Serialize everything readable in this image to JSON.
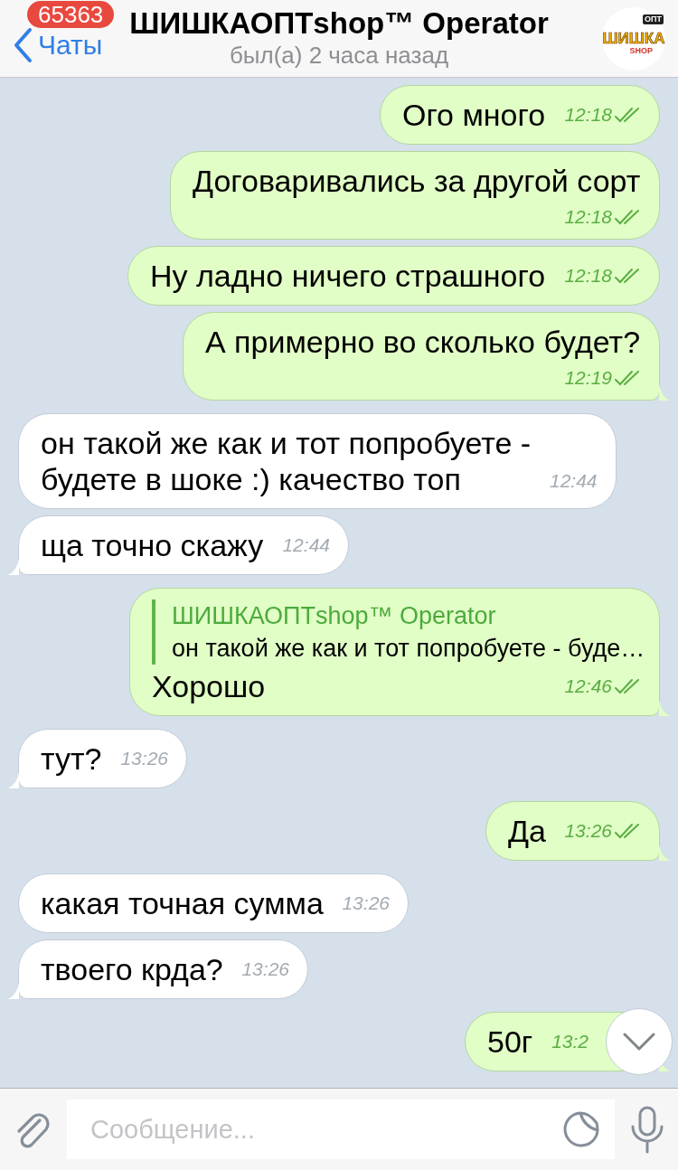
{
  "header": {
    "back_label": "Чаты",
    "unread_badge": "65363",
    "title": "ШИШКАОПТshop™ Operator",
    "status": "был(а) 2 часа назад",
    "avatar": {
      "logo_text": "ШИШКА",
      "logo_subtext": "SHOP",
      "logo_badge": "ОПТ"
    }
  },
  "messages": [
    {
      "kind": "outgoing",
      "text": "Ого много",
      "time": "12:18",
      "read": true,
      "tail": false
    },
    {
      "kind": "outgoing",
      "text": "Договаривались за другой сорт",
      "time": "12:18",
      "read": true,
      "tail": false
    },
    {
      "kind": "outgoing",
      "text": "Ну ладно ничего страшного",
      "time": "12:18",
      "read": true,
      "tail": false
    },
    {
      "kind": "outgoing",
      "text": "А примерно во сколько будет?",
      "time": "12:19",
      "read": true,
      "tail": true
    },
    {
      "kind": "incoming",
      "text": "он такой же как и тот попробуете - будете в шоке :) качество топ",
      "time": "12:44",
      "tail": false
    },
    {
      "kind": "incoming",
      "text": "ща точно скажу",
      "time": "12:44",
      "tail": true
    },
    {
      "kind": "outgoing",
      "reply_to": {
        "author": "ШИШКАОПТshop™ Operator",
        "text": "он такой же как и тот попробуете - буде…"
      },
      "text": "Хорошо",
      "time": "12:46",
      "read": true,
      "tail": true
    },
    {
      "kind": "incoming",
      "text": "тут?",
      "time": "13:26",
      "tail": true
    },
    {
      "kind": "outgoing",
      "text": "Да",
      "time": "13:26",
      "read": true,
      "tail": true
    },
    {
      "kind": "incoming",
      "text": "какая точная сумма",
      "time": "13:26",
      "tail": false
    },
    {
      "kind": "incoming",
      "text": "твоего крда?",
      "time": "13:26",
      "tail": true
    },
    {
      "kind": "outgoing",
      "text": "50г",
      "time": "13:2",
      "tail": true
    }
  ],
  "composer": {
    "placeholder": "Сообщение..."
  }
}
